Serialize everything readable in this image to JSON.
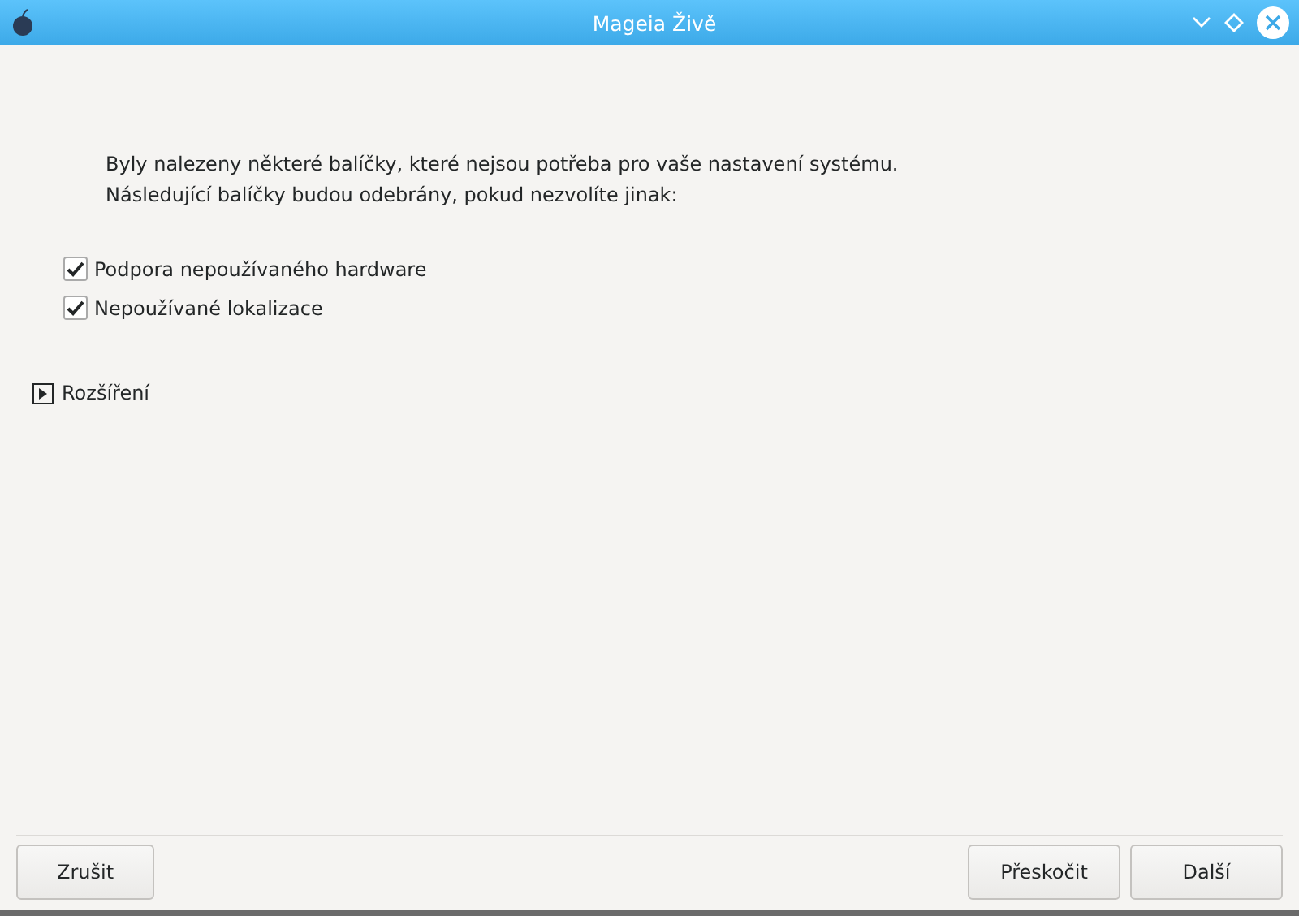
{
  "window": {
    "title": "Mageia Živě"
  },
  "message": [
    "Byly nalezeny některé balíčky, které nejsou potřeba pro vaše nastavení systému.",
    "Následující balíčky budou odebrány, pokud nezvolíte jinak:"
  ],
  "options": [
    {
      "label": "Podpora nepoužívaného hardware",
      "checked": true
    },
    {
      "label": "Nepoužívané lokalizace",
      "checked": true
    }
  ],
  "expander": {
    "label": "Rozšíření",
    "expanded": false
  },
  "buttons": {
    "left": [
      "Zrušit"
    ],
    "right": [
      "Přeskočit",
      "Další"
    ]
  }
}
